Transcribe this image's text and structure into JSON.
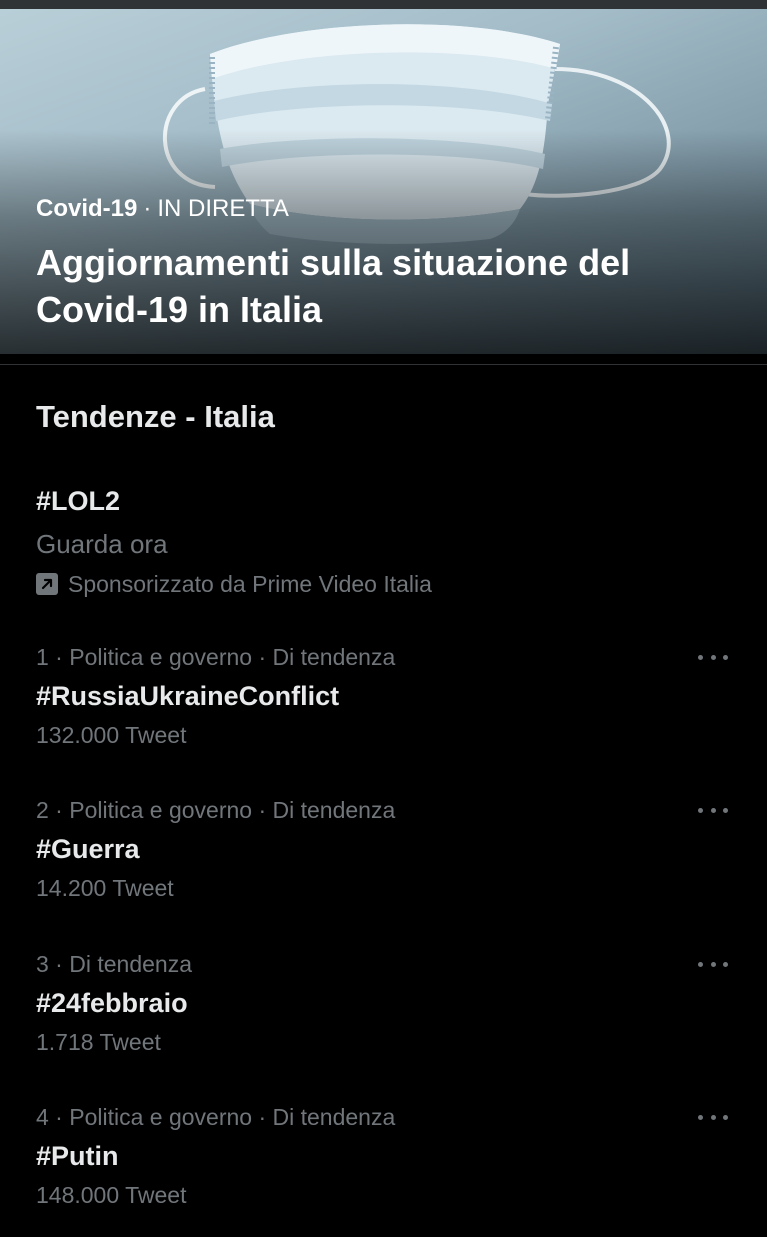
{
  "hero": {
    "category": "Covid-19",
    "separator": "·",
    "status": "IN DIRETTA",
    "title": "Aggiornamenti sulla situazione del Covid-19 in Italia"
  },
  "trends_section": {
    "title": "Tendenze - Italia"
  },
  "promoted": {
    "tag": "#LOL2",
    "subtitle": "Guarda ora",
    "icon": "promoted-arrow-icon",
    "sponsor": "Sponsorizzato da Prime Video Italia"
  },
  "trends": [
    {
      "meta": "1 · Politica e governo · Di tendenza",
      "name": "#RussiaUkraineConflict",
      "count": "132.000 Tweet"
    },
    {
      "meta": "2 · Politica e governo · Di tendenza",
      "name": "#Guerra",
      "count": "14.200 Tweet"
    },
    {
      "meta": "3 · Di tendenza",
      "name": "#24febbraio",
      "count": "1.718 Tweet"
    },
    {
      "meta": "4 · Politica e governo · Di tendenza",
      "name": "#Putin",
      "count": "148.000 Tweet"
    }
  ],
  "colors": {
    "background": "#000000",
    "primary_text": "#e7e9ea",
    "secondary_text": "#71767b",
    "divider": "#2f3336"
  },
  "icons": {
    "more": "more-options-icon"
  }
}
